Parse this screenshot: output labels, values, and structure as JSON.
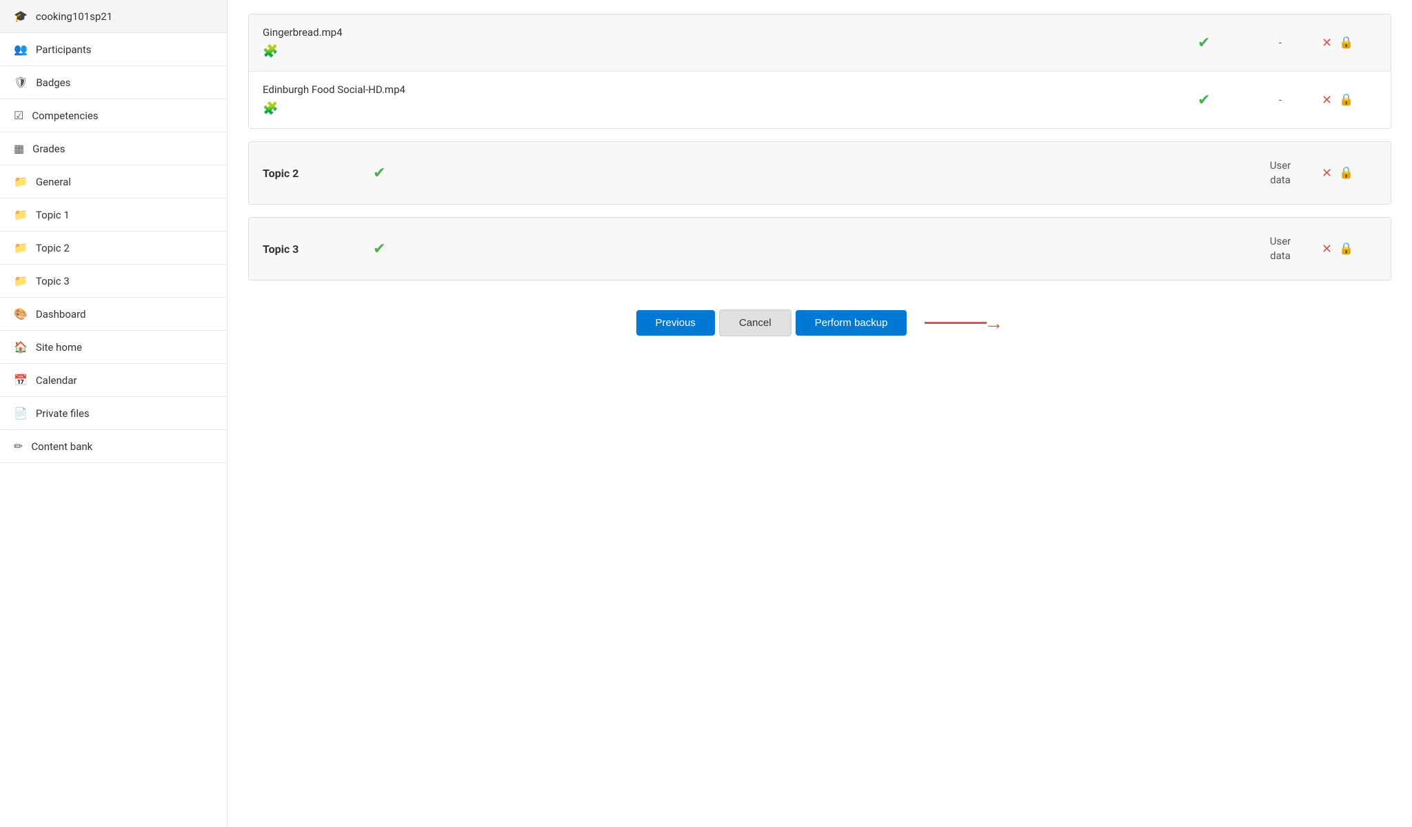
{
  "sidebar": {
    "items": [
      {
        "id": "course",
        "label": "cooking101sp21",
        "icon": "🎓"
      },
      {
        "id": "participants",
        "label": "Participants",
        "icon": "👥"
      },
      {
        "id": "badges",
        "label": "Badges",
        "icon": "🛡"
      },
      {
        "id": "competencies",
        "label": "Competencies",
        "icon": "☑"
      },
      {
        "id": "grades",
        "label": "Grades",
        "icon": "▦"
      },
      {
        "id": "general",
        "label": "General",
        "icon": "📁"
      },
      {
        "id": "topic1",
        "label": "Topic 1",
        "icon": "📁"
      },
      {
        "id": "topic2",
        "label": "Topic 2",
        "icon": "📁"
      },
      {
        "id": "topic3",
        "label": "Topic 3",
        "icon": "📁"
      },
      {
        "id": "dashboard",
        "label": "Dashboard",
        "icon": "🎨"
      },
      {
        "id": "sitehome",
        "label": "Site home",
        "icon": "🏠"
      },
      {
        "id": "calendar",
        "label": "Calendar",
        "icon": "📅"
      },
      {
        "id": "privatefiles",
        "label": "Private files",
        "icon": "📄"
      },
      {
        "id": "contentbank",
        "label": "Content bank",
        "icon": "✏"
      }
    ]
  },
  "main": {
    "sections": [
      {
        "id": "gingerbread-section",
        "rows": [
          {
            "id": "gingerbread-row",
            "name": "Gingerbread.mp4",
            "has_puzzle": true,
            "check": "✔",
            "status": "-",
            "has_x": true,
            "has_lock": true
          },
          {
            "id": "edinburgh-row",
            "name": "Edinburgh Food Social-HD.mp4",
            "has_puzzle": true,
            "check": "✔",
            "status": "-",
            "has_x": true,
            "has_lock": true
          }
        ]
      },
      {
        "id": "topic2-section",
        "is_topic": true,
        "topic_name": "Topic 2",
        "check": "✔",
        "status": "User\ndata",
        "has_x": true,
        "has_lock": true
      },
      {
        "id": "topic3-section",
        "is_topic": true,
        "topic_name": "Topic 3",
        "check": "✔",
        "status": "User\ndata",
        "has_x": true,
        "has_lock": true
      }
    ],
    "buttons": {
      "previous": "Previous",
      "cancel": "Cancel",
      "perform_backup": "Perform backup"
    }
  }
}
